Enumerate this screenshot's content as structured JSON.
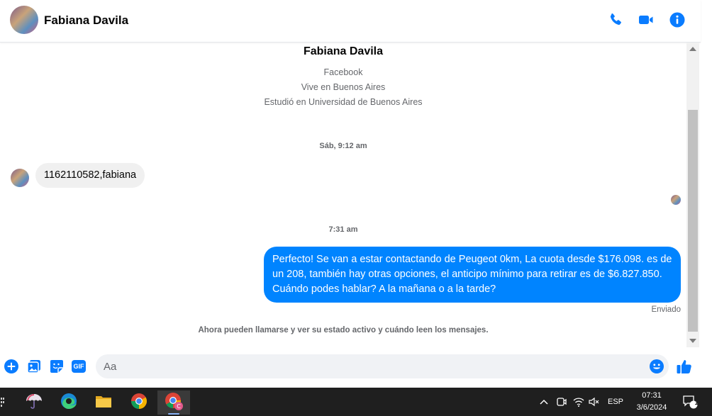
{
  "header": {
    "contact_name": "Fabiana Davila",
    "actions": [
      "phone-icon",
      "video-icon",
      "info-icon"
    ]
  },
  "profile": {
    "name": "Fabiana Davila",
    "line1": "Facebook",
    "line2": "Vive en Buenos Aires",
    "line3": "Estudió en Universidad de Buenos Aires"
  },
  "conversation": {
    "timestamp1": "Sáb, 9:12 am",
    "incoming_message": "1162110582,fabiana",
    "timestamp2": "7:31 am",
    "outgoing_message": "Perfecto!  Se van a estar contactando de Peugeot 0km, La cuota desde $176.098. es de un 208, también hay otras opciones, el anticipo mínimo para retirar es de $6.827.850. Cuándo podes hablar? A la mañana o a la tarde?",
    "outgoing_status": "Enviado",
    "notice": "Ahora pueden llamarse y ver su estado activo y cuándo leen los mensajes."
  },
  "composer": {
    "placeholder": "Aa",
    "gif_label": "GIF"
  },
  "taskbar": {
    "language": "ESP",
    "time": "07:31",
    "date": "3/6/2024",
    "notification_count": "1"
  },
  "colors": {
    "accent": "#0084ff",
    "icon_blue": "#0a7cff",
    "incoming_bubble": "#f0f0f0"
  }
}
